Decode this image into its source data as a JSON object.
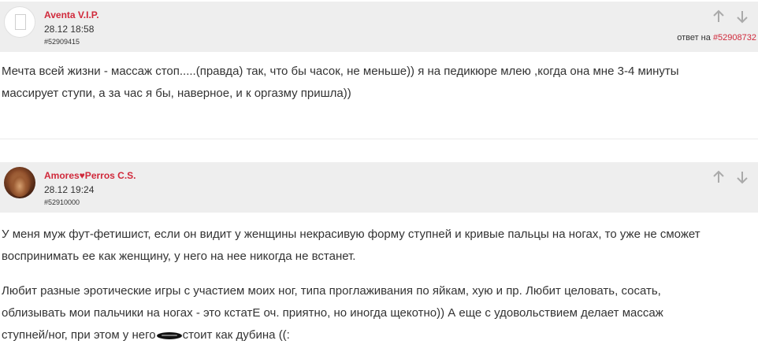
{
  "comments": [
    {
      "username": "Aventa V.I.P.",
      "date": "28.12 18:58",
      "id": "#52909415",
      "reply_prefix": "ответ на",
      "reply_to": "#52908732",
      "text_lines": [
        "Мечта всей жизни - массаж стоп.....(правда) так, что бы часок, не меньше)) я на педикюре млею ,когда она мне 3-4 минуты",
        "массирует ступи, а за час я бы, наверное, и к оргазму пришла))"
      ]
    },
    {
      "username": "Amores♥Perros C.S.",
      "date": "28.12 19:24",
      "id": "#52910000",
      "paragraph1_lines": [
        "У меня муж фут-фетишист, если он видит у женщины некрасивую форму ступней и кривые пальцы на ногах, то уже не сможет",
        "воспринимать ее как женщину, у него на нее никогда не встанет."
      ],
      "paragraph2_lines": [
        "Любит разные эротические игры с участием моих ног, типа проглаживания по яйкам, хую и пр. Любит целовать, сосать,",
        "облизывать мои пальчики на ногах - это кстатЕ оч. приятно, но иногда щекотно)) А еще с удовольствием делает массаж"
      ],
      "last_line_before": "ступней/ног, при этом у него",
      "last_line_after": "стоит как дубина ((:"
    }
  ],
  "icons": {
    "upvote": "arrow-up-icon",
    "downvote": "arrow-down-icon",
    "censor": "censor-blot"
  },
  "colors": {
    "accent": "#d0293b",
    "header_bg": "#eeeeee",
    "text": "#333333",
    "icon": "#aaaaaa"
  }
}
